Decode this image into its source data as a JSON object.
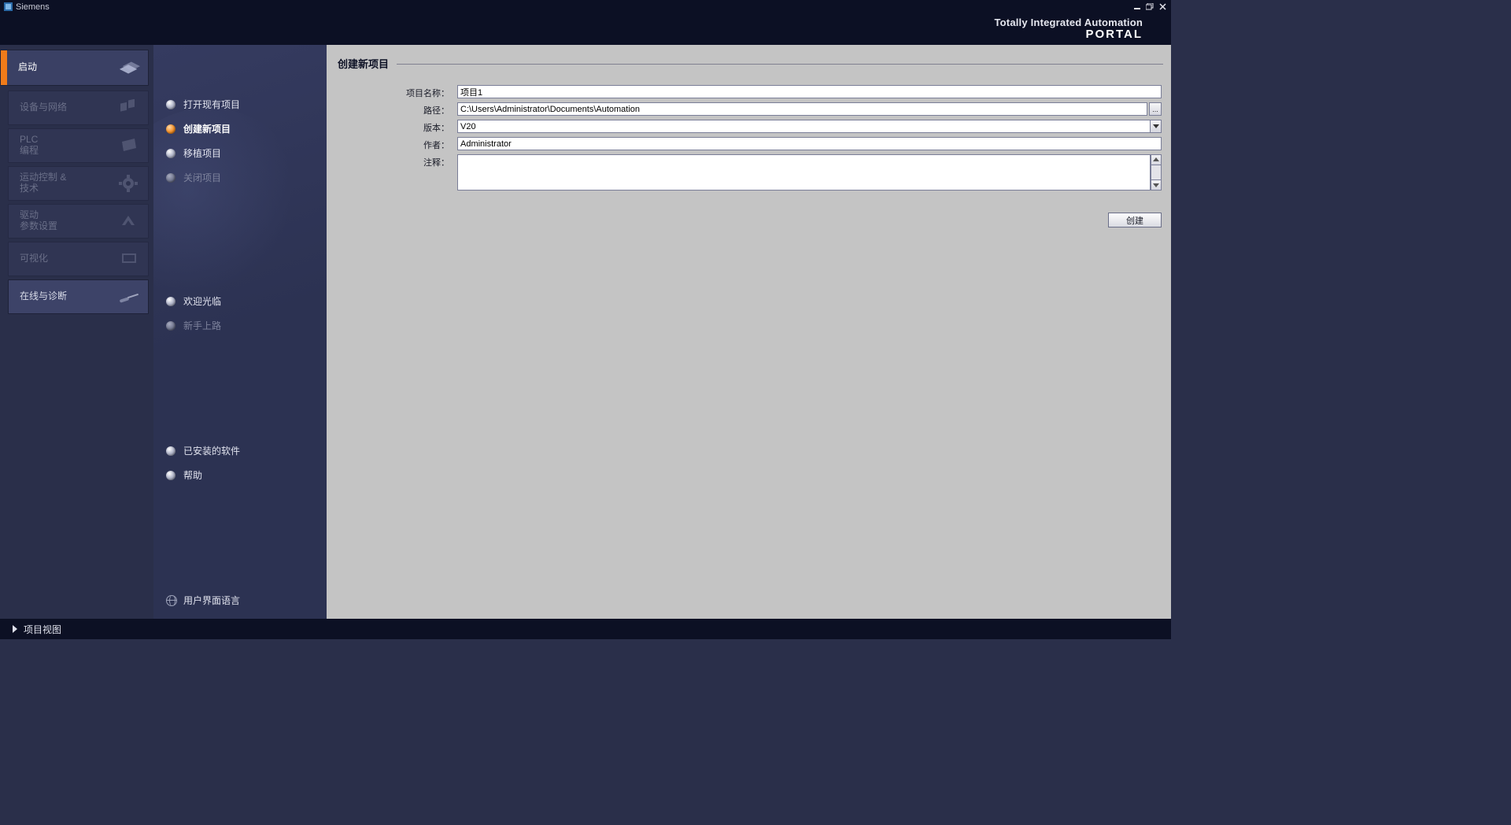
{
  "titlebar": {
    "app_name": "Siemens"
  },
  "header": {
    "brand_line1": "Totally Integrated Automation",
    "brand_line2": "PORTAL"
  },
  "nav": {
    "start": "启动",
    "devices": "设备与网络",
    "plc1": "PLC",
    "plc2": "编程",
    "motion1": "运动控制 &",
    "motion2": "技术",
    "drive1": "驱动",
    "drive2": "参数设置",
    "visual": "可视化",
    "online": "在线与诊断"
  },
  "actions": {
    "open_existing": "打开现有项目",
    "create_new": "创建新项目",
    "migrate": "移植项目",
    "close": "关闭项目",
    "welcome": "欢迎光临",
    "first_steps": "新手上路",
    "installed_sw": "已安装的软件",
    "help": "帮助",
    "ui_language": "用户界面语言"
  },
  "main": {
    "title": "创建新项目",
    "labels": {
      "project_name": "项目名称：",
      "path": "路径：",
      "version": "版本：",
      "author": "作者：",
      "comment": "注释："
    },
    "values": {
      "project_name": "项目1",
      "path": "C:\\Users\\Administrator\\Documents\\Automation",
      "version": "V20",
      "author": "Administrator",
      "comment": ""
    },
    "browse_btn": "...",
    "create_btn": "创建"
  },
  "footer": {
    "project_view": "项目视图"
  }
}
